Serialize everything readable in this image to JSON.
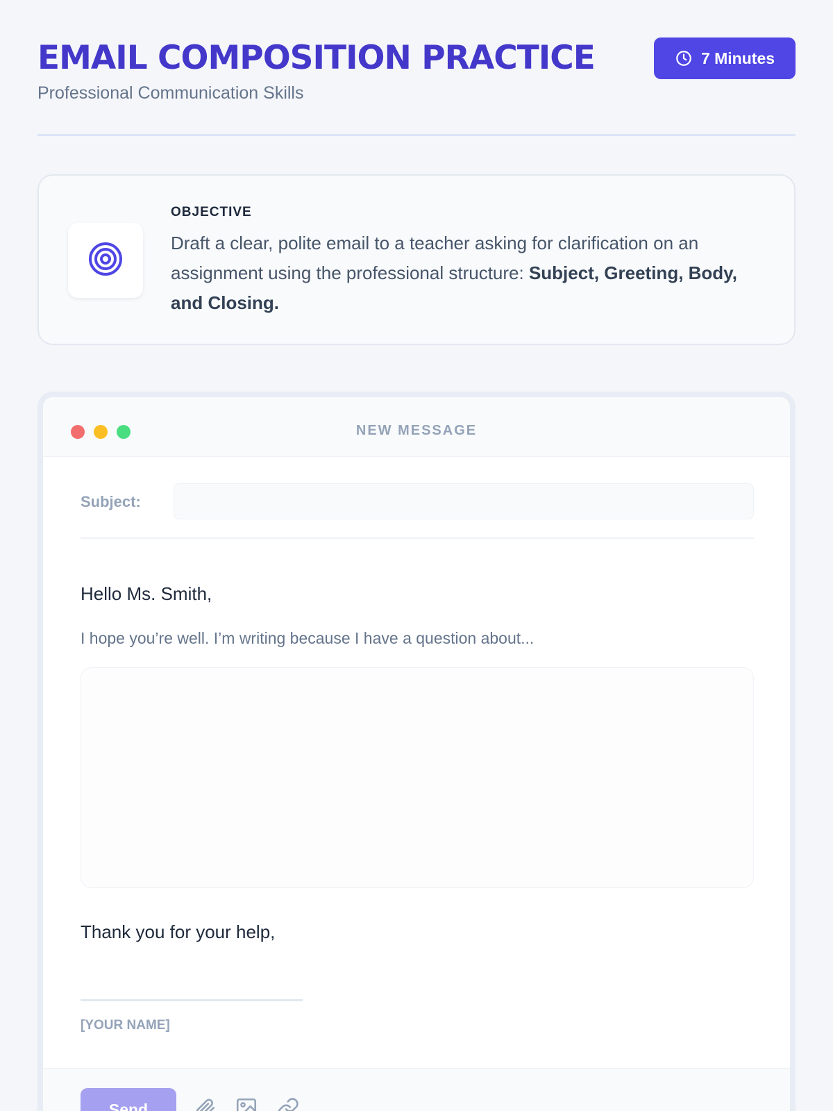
{
  "header": {
    "title": "Email Composition Practice",
    "subtitle": "Professional Communication Skills",
    "time_badge": {
      "label": "7 Minutes",
      "icon": "clock-icon"
    }
  },
  "objective": {
    "icon": "target-icon",
    "label": "OBJECTIVE",
    "text_plain": "Draft a clear, polite email to a teacher asking for clarification on an assignment using the professional structure: ",
    "text_bold": "Subject, Greeting, Body, and Closing."
  },
  "email": {
    "window_title": "NEW MESSAGE",
    "window_dots": [
      "#f26d6d",
      "#fbbf24",
      "#4ade80"
    ],
    "subject_label": "Subject:",
    "subject_value": "",
    "greeting": "Hello Ms. Smith,",
    "opening_line": "I hope you’re well. I’m writing because I have a question about...",
    "body_value": "",
    "closing": "Thank you for your help,",
    "signature_placeholder": "[YOUR NAME]",
    "send_label": "Send",
    "toolbar_icons": [
      "paperclip-icon",
      "image-icon",
      "link-icon"
    ]
  },
  "colors": {
    "accent": "#4f46e5",
    "title": "#4338ca",
    "send_button": "#a5a0f0"
  }
}
